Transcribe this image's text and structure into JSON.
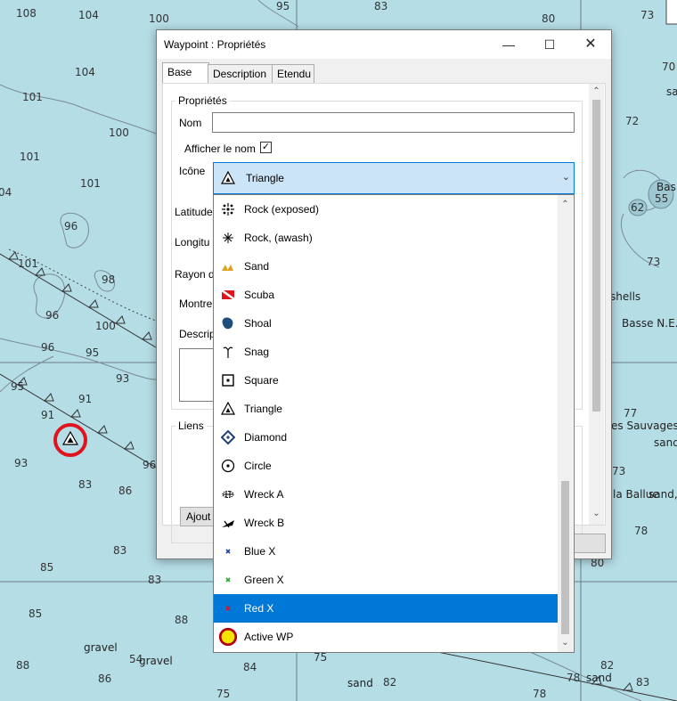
{
  "map": {
    "soundings": [
      "108",
      "104",
      "100",
      "95",
      "83",
      "80",
      "73",
      "104",
      "70",
      "101",
      "72",
      "100",
      "101",
      "101",
      "04",
      "96",
      "62",
      "55",
      "101",
      "73",
      "98",
      "96",
      "100",
      "96",
      "95",
      "93",
      "95",
      "91",
      "91",
      "77",
      "93",
      "96",
      "83",
      "86",
      "73",
      "78",
      "83",
      "85",
      "83",
      "80",
      "85",
      "88",
      "75",
      "88",
      "86",
      "75",
      "78",
      "82",
      "83",
      "82",
      "78",
      "84",
      "54"
    ],
    "labels": [
      "sa",
      "Bas",
      "shells",
      "Basse N.E.",
      "es Sauvages",
      "sand",
      "la Ballue",
      "sand,r",
      "gravel",
      "gravel",
      "sand",
      "sand"
    ]
  },
  "dialog": {
    "title": "Waypoint : Propriétés",
    "minimize_icon": "minimize-icon",
    "maximize_icon": "maximize-icon",
    "close_icon": "close-icon",
    "tabs": [
      "Base",
      "Description",
      "Etendu"
    ],
    "active_tab": "Base",
    "properties_group": "Propriétés",
    "name_label": "Nom",
    "name_value": "",
    "show_name_label": "Afficher le nom",
    "show_name_checked": true,
    "icon_label": "Icône",
    "latitude_label": "Latitude",
    "longitude_label": "Longitu",
    "radius_label": "Rayon d",
    "show_label": "Montre",
    "description_label": "Descrip",
    "links_group": "Liens",
    "add_button": "Ajout"
  },
  "combo": {
    "selected": "Triangle",
    "selected_icon": "triangle-icon"
  },
  "dropdown": {
    "items": [
      {
        "label": "Rock (exposed)",
        "icon": "rock-exposed-icon"
      },
      {
        "label": "Rock, (awash)",
        "icon": "rock-awash-icon"
      },
      {
        "label": "Sand",
        "icon": "sand-icon"
      },
      {
        "label": "Scuba",
        "icon": "scuba-icon"
      },
      {
        "label": "Shoal",
        "icon": "shoal-icon"
      },
      {
        "label": "Snag",
        "icon": "snag-icon"
      },
      {
        "label": "Square",
        "icon": "square-icon"
      },
      {
        "label": "Triangle",
        "icon": "triangle-icon"
      },
      {
        "label": "Diamond",
        "icon": "diamond-icon"
      },
      {
        "label": "Circle",
        "icon": "circle-icon"
      },
      {
        "label": "Wreck A",
        "icon": "wreck-a-icon"
      },
      {
        "label": "Wreck B",
        "icon": "wreck-b-icon"
      },
      {
        "label": "Blue X",
        "icon": "blue-x-icon"
      },
      {
        "label": "Green X",
        "icon": "green-x-icon"
      },
      {
        "label": "Red X",
        "icon": "red-x-icon"
      },
      {
        "label": "Active WP",
        "icon": "active-wp-icon"
      }
    ],
    "highlighted": "Red X"
  },
  "colors": {
    "sea": "#b5dde6",
    "selection": "#0078d7",
    "combo_bg": "#cce4f7",
    "waypoint_ring": "#e0141e"
  }
}
